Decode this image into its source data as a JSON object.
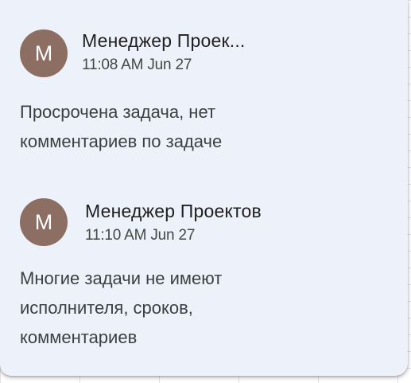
{
  "comments": [
    {
      "avatar_letter": "M",
      "author": "Менеджер Проек...",
      "timestamp": "11:08 AM Jun 27",
      "body_lines": [
        "Просрочена задача, нет",
        "комментариев по задаче"
      ]
    },
    {
      "avatar_letter": "M",
      "author": "Менеджер Проектов",
      "timestamp": "11:10 AM Jun 27",
      "body_lines": [
        "Многие задачи не имеют",
        "исполнителя, сроков,",
        "комментариев"
      ]
    }
  ],
  "colors": {
    "popup_background": "#edf1fa",
    "avatar_background": "#8d6e63",
    "author_text": "#1f1f1f",
    "meta_text": "#444746",
    "body_text": "#3c4043"
  }
}
